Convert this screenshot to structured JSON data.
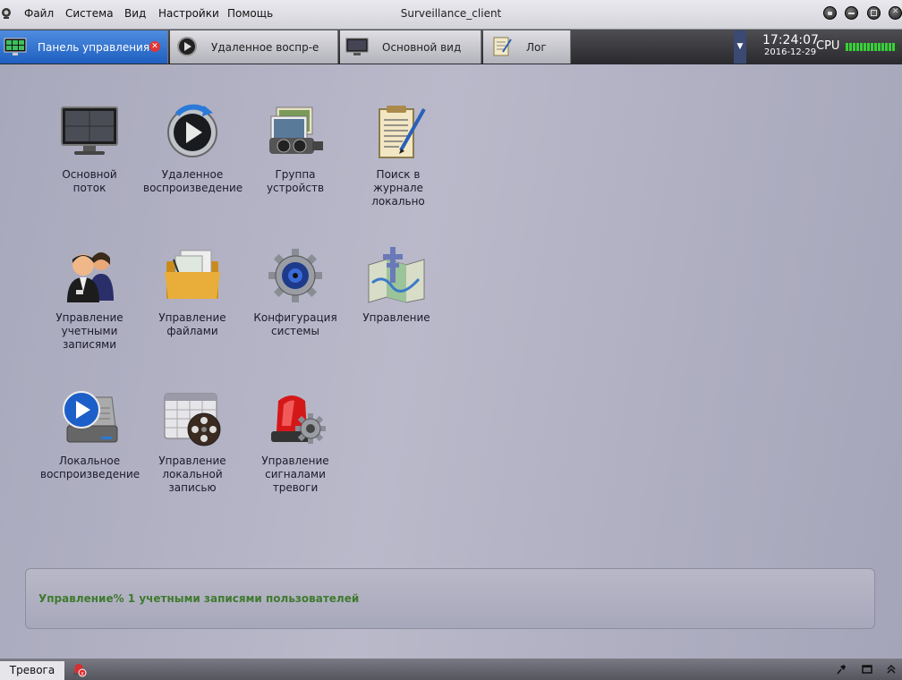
{
  "window": {
    "title": "Surveillance_client"
  },
  "menu": [
    "Файл",
    "Система",
    "Вид",
    "Настройки",
    "Помощь"
  ],
  "tabs": [
    {
      "label": "Панель управления",
      "icon": "monitor-grid-icon",
      "active": true
    },
    {
      "label": "Удаленное воспр-е",
      "icon": "remote-playback-icon"
    },
    {
      "label": "Основной вид",
      "icon": "monitor-icon"
    },
    {
      "label": "Лог",
      "icon": "log-notepad-icon"
    }
  ],
  "clock": {
    "time": "17:24:07",
    "date": "2016-12-29"
  },
  "cpu": {
    "label": "CPU",
    "level": 0.9
  },
  "modules": [
    {
      "label": "Основной\nпоток",
      "icon": "monitor-icon"
    },
    {
      "label": "Удаленное\nвоспроизведение",
      "icon": "remote-playback-icon"
    },
    {
      "label": "Группа\nустройств",
      "icon": "device-group-icon"
    },
    {
      "label": "Поиск в\nжурнале\nлокально",
      "icon": "log-search-icon"
    },
    {
      "label": "Управление\nучетными\nзаписями",
      "icon": "users-icon"
    },
    {
      "label": "Управление\nфайлами",
      "icon": "folder-icon"
    },
    {
      "label": "Конфигурация\nсистемы",
      "icon": "gear-icon"
    },
    {
      "label": "Управление",
      "icon": "map-icon"
    },
    {
      "label": "Локальное\nвоспроизведение",
      "icon": "local-playback-icon"
    },
    {
      "label": "Управление\nлокальной\nзаписью",
      "icon": "record-schedule-icon"
    },
    {
      "label": "Управление\nсигналами\nтревоги",
      "icon": "alarm-siren-icon"
    }
  ],
  "status": {
    "message": "Управление% 1 учетными записями пользователей"
  },
  "bottom": {
    "alarm_tab": "Тревога"
  },
  "colors": {
    "accent": "#2a6fd0",
    "status_text": "#3f7a2e"
  }
}
